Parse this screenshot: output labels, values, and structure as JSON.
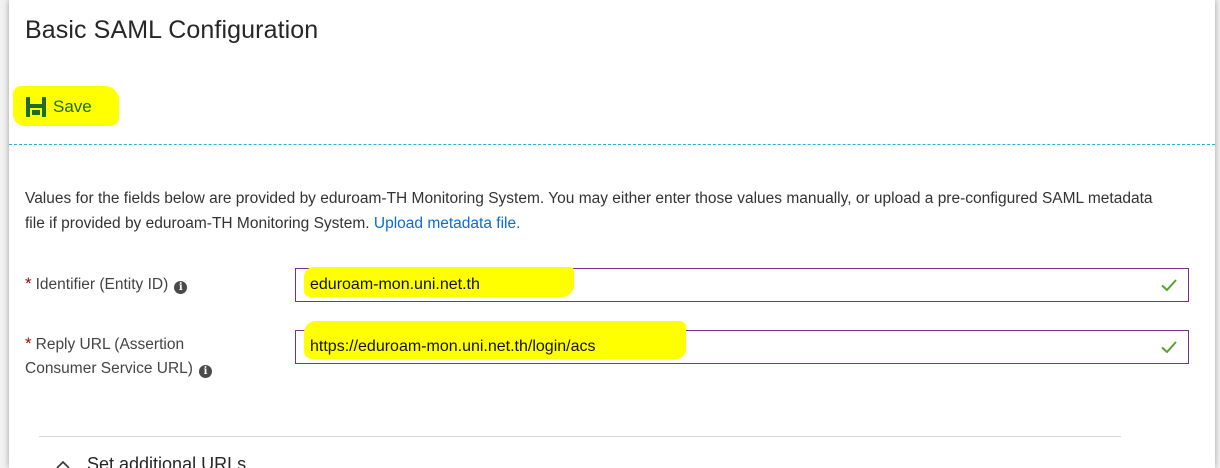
{
  "header": {
    "title": "Basic SAML Configuration"
  },
  "toolbar": {
    "save_label": "Save",
    "save_icon": "save-icon"
  },
  "form": {
    "description": "Values for the fields below are provided by eduroam-TH Monitoring System. You may either enter those values manually, or upload a pre-configured SAML metadata file if provided by eduroam-TH Monitoring System.",
    "upload_link": "Upload metadata file.",
    "required_marker": "*",
    "identifier": {
      "label": "Identifier (Entity ID)",
      "value": "eduroam-mon.uni.net.th"
    },
    "reply_url": {
      "label_line1": "Reply URL (Assertion",
      "label_line2": "Consumer Service URL)",
      "value": "https://eduroam-mon.uni.net.th/login/acs"
    }
  },
  "additional": {
    "label": "Set additional URLs"
  },
  "colors": {
    "highlight": "#ffff00",
    "input_border": "#7a2e8e",
    "check": "#5aa02c",
    "link": "#0a6cd6",
    "divider": "#2ab3d6",
    "required": "#b00000"
  }
}
